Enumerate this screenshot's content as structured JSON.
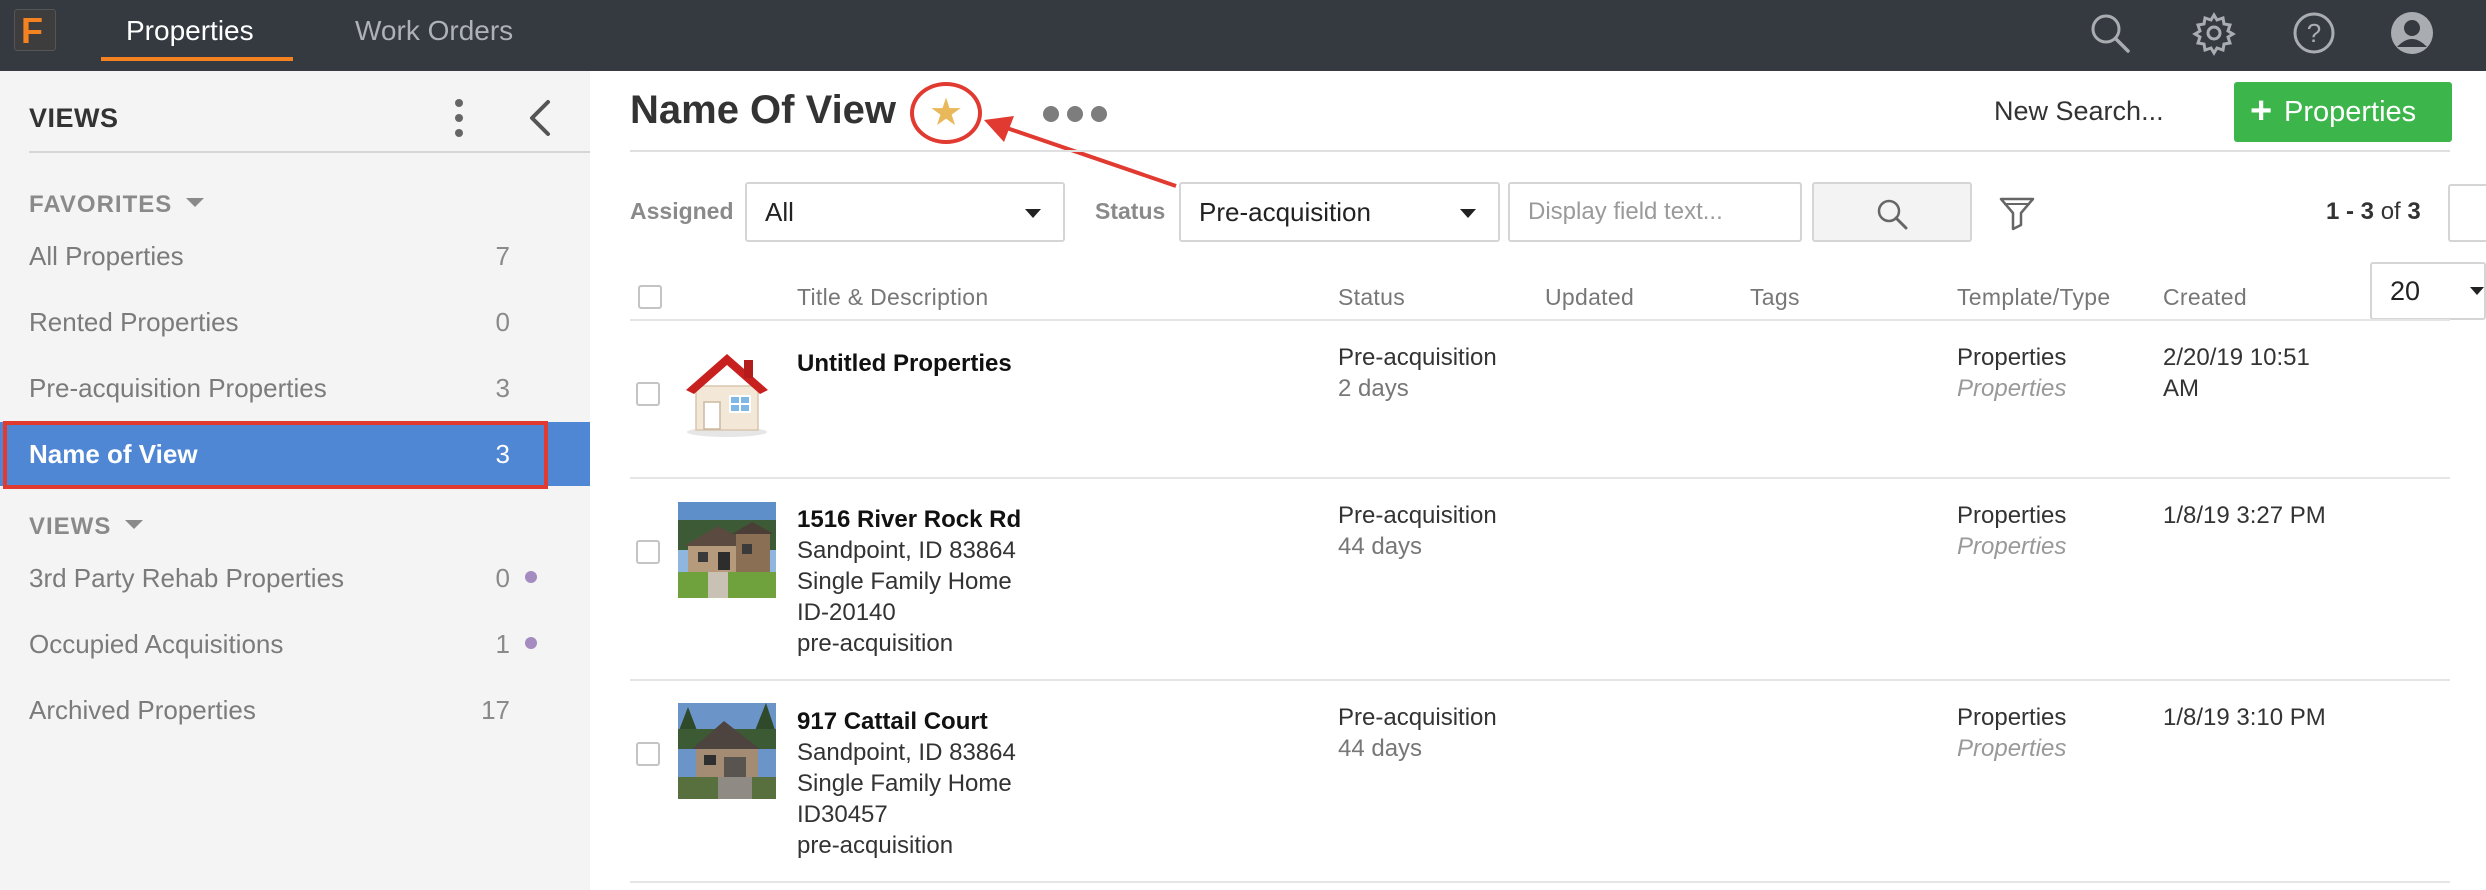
{
  "app": {
    "logo_letter": "F",
    "nav_tabs": [
      {
        "label": "Properties",
        "active": true
      },
      {
        "label": "Work Orders",
        "active": false
      }
    ],
    "icons": [
      "search-icon",
      "gear-icon",
      "help-icon",
      "user-avatar-icon"
    ],
    "colors": {
      "topbar": "#343a40",
      "accent": "#f58220",
      "primary_blue": "#4f87d4",
      "green": "#3cb64b",
      "highlight_red": "#e03a31",
      "star": "#e8b85a"
    }
  },
  "sidebar": {
    "header": "VIEWS",
    "favorites_label": "FAVORITES",
    "favorites": [
      {
        "label": "All Properties",
        "count": "7"
      },
      {
        "label": "Rented Properties",
        "count": "0"
      },
      {
        "label": "Pre-acquisition Properties",
        "count": "3"
      },
      {
        "label": "Name of View",
        "count": "3",
        "active": true
      }
    ],
    "views_label": "VIEWS",
    "views": [
      {
        "label": "3rd Party Rehab Properties",
        "count": "0",
        "dot": true
      },
      {
        "label": "Occupied Acquisitions",
        "count": "1",
        "dot": true
      },
      {
        "label": "Archived Properties",
        "count": "17",
        "dot": false
      }
    ]
  },
  "main": {
    "title": "Name Of View",
    "new_search_label": "New Search...",
    "add_button_label": "Properties",
    "filters": {
      "assigned_label": "Assigned",
      "assigned_value": "All",
      "status_label": "Status",
      "status_value": "Pre-acquisition",
      "search_placeholder": "Display field text..."
    },
    "pager": {
      "range": "1 - 3",
      "of_label": "of",
      "total": "3"
    },
    "page_size": "20",
    "columns": [
      "Title & Description",
      "Status",
      "Updated",
      "Tags",
      "Template/Type",
      "Created"
    ],
    "rows": [
      {
        "title": "Untitled Properties",
        "desc": [],
        "status": "Pre-acquisition",
        "age": "2 days",
        "template": "Properties",
        "type": "Properties",
        "created_1": "2/20/19 10:51",
        "created_2": "AM",
        "thumb": "house-icon"
      },
      {
        "title": "1516 River Rock Rd",
        "desc": [
          "Sandpoint, ID 83864",
          "Single Family Home",
          "ID-20140",
          "pre-acquisition"
        ],
        "status": "Pre-acquisition",
        "age": "44 days",
        "template": "Properties",
        "type": "Properties",
        "created_1": "1/8/19 3:27 PM",
        "created_2": "",
        "thumb": "property-photo"
      },
      {
        "title": "917 Cattail Court",
        "desc": [
          "Sandpoint, ID 83864",
          "Single Family Home",
          "ID30457",
          "pre-acquisition"
        ],
        "status": "Pre-acquisition",
        "age": "44 days",
        "template": "Properties",
        "type": "Properties",
        "created_1": "1/8/19 3:10 PM",
        "created_2": "",
        "thumb": "property-photo"
      }
    ]
  }
}
